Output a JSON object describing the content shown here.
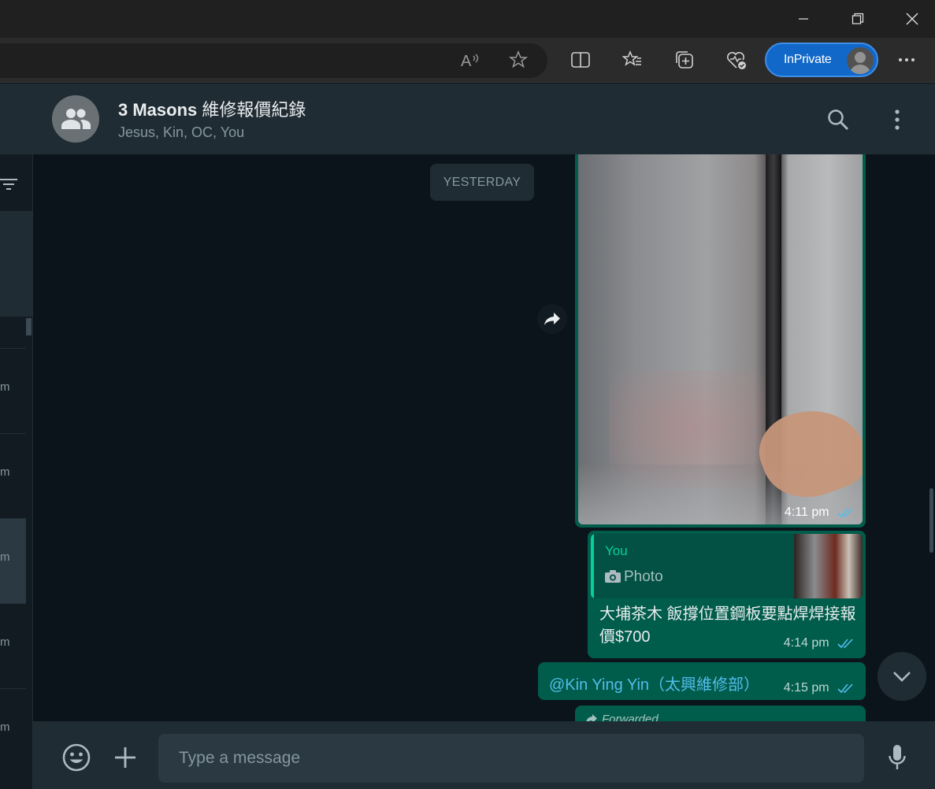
{
  "browser": {
    "inprivate_label": "InPrivate",
    "icons": [
      "read-aloud-icon",
      "favorite-star-icon",
      "split-screen-icon",
      "favorites-icon",
      "collections-icon",
      "browser-essentials-icon",
      "more-icon"
    ]
  },
  "sidebar": {
    "items": [
      {
        "time_fragment": "m"
      },
      {
        "time_fragment": "m"
      },
      {
        "time_fragment": "m"
      },
      {
        "time_fragment": "m"
      },
      {
        "time_fragment": "m"
      }
    ]
  },
  "chat": {
    "title_bold": "3 Masons",
    "title_rest": " 維修報價紀錄",
    "participants": "Jesus, Kin, OC, You"
  },
  "conversation": {
    "date_chip": "YESTERDAY",
    "messages": [
      {
        "type": "image",
        "time": "4:11 pm",
        "status": "read"
      },
      {
        "type": "reply",
        "quote_author": "You",
        "quote_type": "Photo",
        "text": "大埔茶木 飯撐位置鋼板要點焊焊接報價$700",
        "time": "4:14 pm",
        "status": "read"
      },
      {
        "type": "text",
        "text": "@Kin Ying Yin（太興維修部）",
        "time": "4:15 pm",
        "status": "read"
      },
      {
        "type": "forwarded",
        "label": "Forwarded"
      }
    ]
  },
  "composer": {
    "placeholder": "Type a message"
  },
  "colors": {
    "outgoing_bubble": "#005c4b",
    "background": "#0b141a",
    "header": "#202c33",
    "accent_green": "#06cf9c",
    "read_ticks": "#53bdeb",
    "inprivate_blue": "#1168c8"
  }
}
